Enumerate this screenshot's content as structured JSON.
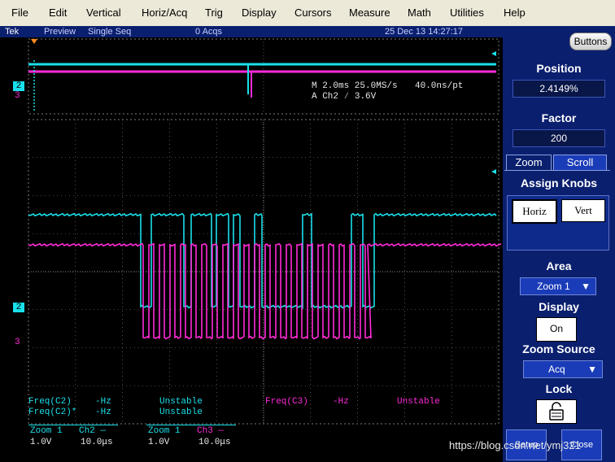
{
  "menu": {
    "items": [
      "File",
      "Edit",
      "Vertical",
      "Horiz/Acq",
      "Trig",
      "Display",
      "Cursors",
      "Measure",
      "Math",
      "Utilities",
      "Help"
    ]
  },
  "status": {
    "brand": "Tek",
    "mode": "Preview",
    "acq_mode": "Single Seq",
    "acqs": "0 Acqs",
    "datetime": "25 Dec 13 14:27:17"
  },
  "overview": {
    "timebase": "M 2.0ms 25.0MS/s",
    "resolution": "40.0ns/pt",
    "trigger_source": "A  Ch2",
    "trigger_slope": "∕",
    "trigger_level": "3.6V"
  },
  "markers": {
    "ch2": "2",
    "ch3": "3"
  },
  "measurements": [
    {
      "name": "Freq(C2)",
      "value": "-Hz",
      "status": "Unstable"
    },
    {
      "name": "Freq(C2)*",
      "value": "-Hz",
      "status": "Unstable"
    },
    {
      "name": "Freq(C3)",
      "value": "-Hz",
      "status": "Unstable"
    }
  ],
  "channel_info": [
    {
      "zoom": "Zoom 1",
      "channel": "Ch2 —",
      "volts": "1.0V",
      "time": "10.0μs"
    },
    {
      "zoom": "Zoom 1",
      "channel": "Ch3 —",
      "volts": "1.0V",
      "time": "10.0μs"
    }
  ],
  "panel": {
    "buttons_label": "Buttons",
    "position_title": "Position",
    "position_value": "2.4149%",
    "factor_title": "Factor",
    "factor_value": "200",
    "tab_zoom": "Zoom",
    "tab_scroll": "Scroll",
    "assign_title": "Assign Knobs",
    "knob_horiz": "Horiz",
    "knob_vert": "Vert",
    "area_title": "Area",
    "area_value": "Zoom 1",
    "display_title": "Display",
    "display_value": "On",
    "zoom_source_title": "Zoom Source",
    "zoom_source_value": "Acq",
    "lock_title": "Lock",
    "setup_label": "Setup",
    "close_label": "Close"
  },
  "watermark": "https://blog.csdn.net/ymj321",
  "colors": {
    "ch2": "#19e0ea",
    "ch3": "#ff2bd8",
    "panel": "#0a1f6e",
    "grid": "#8a8a8a"
  }
}
